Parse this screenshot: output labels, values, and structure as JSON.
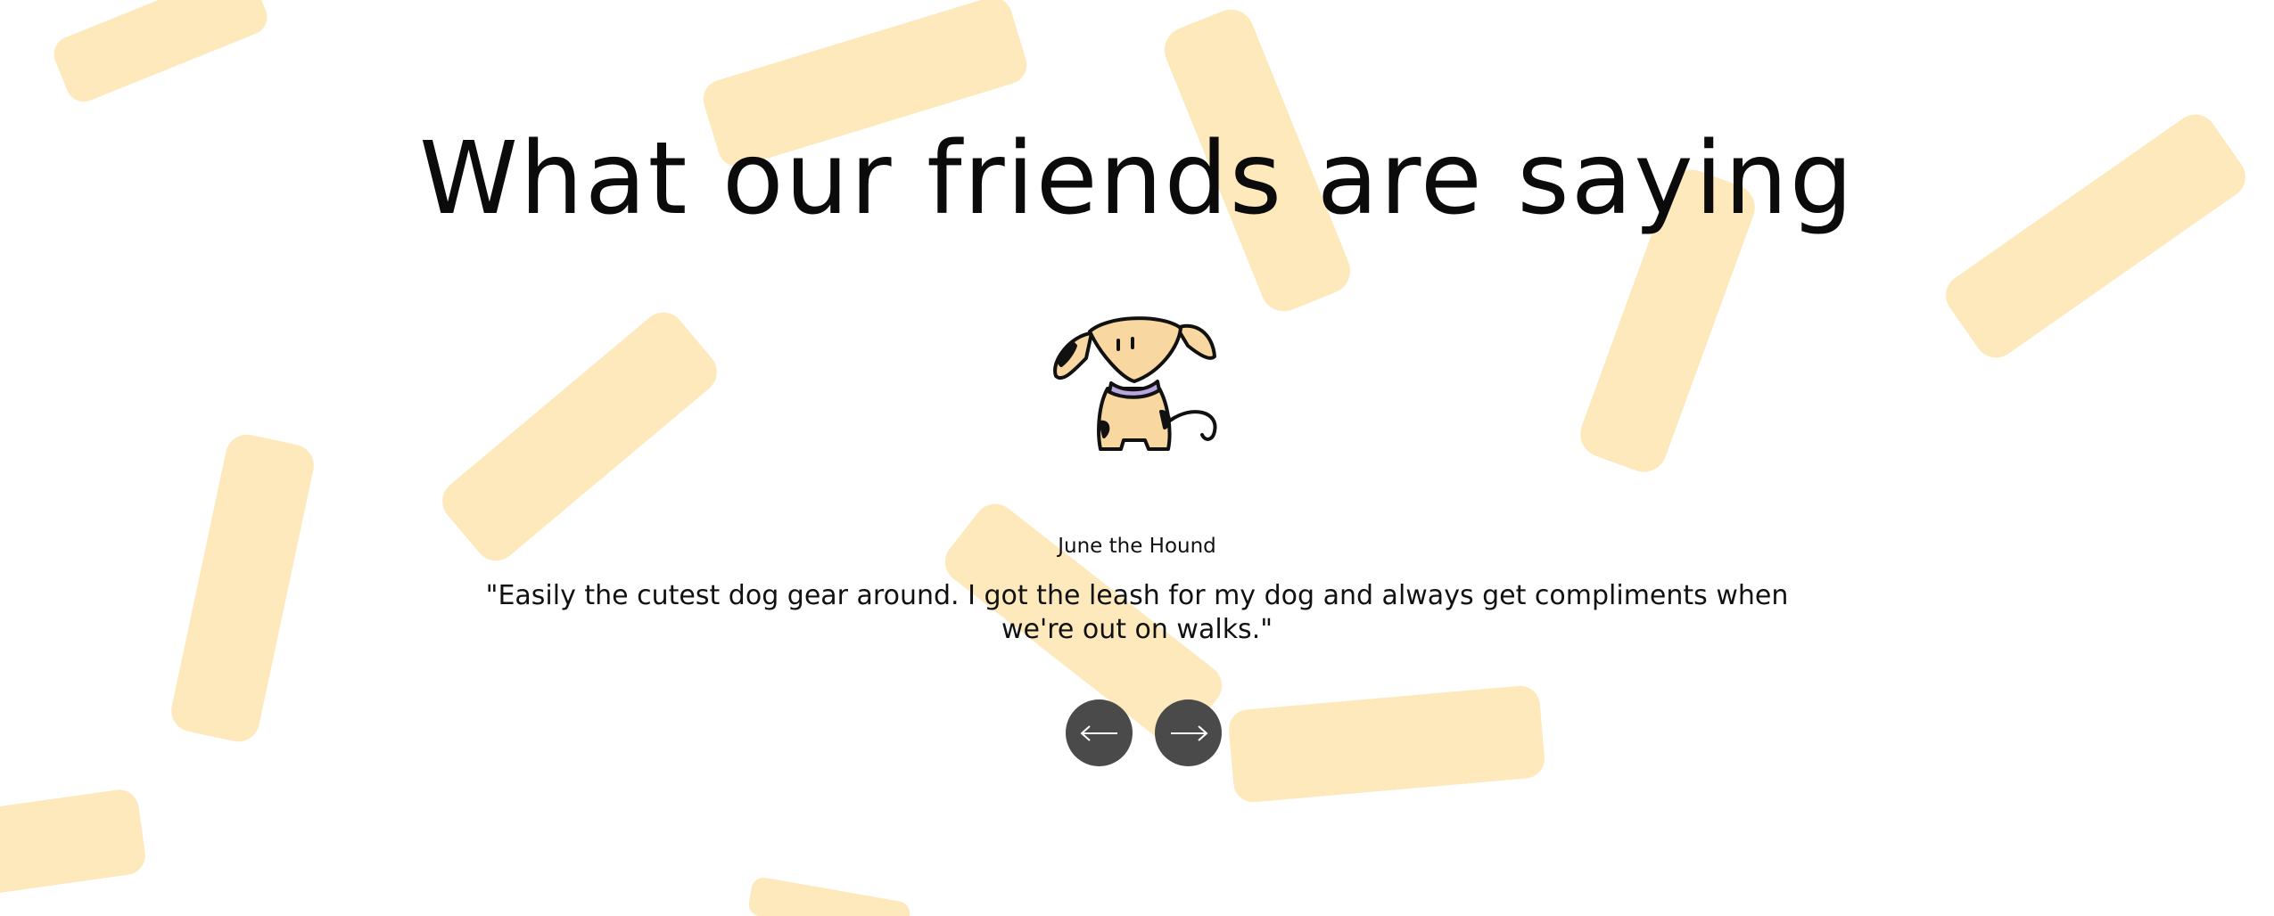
{
  "section": {
    "title": "What our friends are saying"
  },
  "testimonial": {
    "author": "June the Hound",
    "quote": "\"Easily the cutest dog gear around. I got the leash for my dog and always get compliments when we're out on walks.\"",
    "illustration_icon": "dog-illustration"
  },
  "navigation": {
    "previous_icon": "arrow-left-icon",
    "next_icon": "arrow-right-icon"
  },
  "colors": {
    "background": "#ffffff",
    "brush_stroke": "#fde8b8",
    "button": "#4a4a4a",
    "text": "#0b0b0b"
  }
}
